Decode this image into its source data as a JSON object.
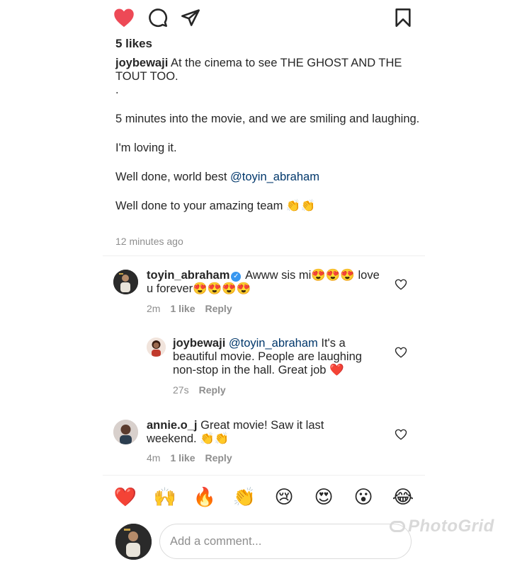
{
  "post": {
    "likes": "5 likes",
    "caption_user": "joybewaji",
    "caption_line1": "At the cinema to see THE GHOST AND THE TOUT TOO.",
    "caption_dot": ".",
    "caption_line2": "5 minutes into the movie, and we are smiling and laughing.",
    "caption_line3": "I'm loving it.",
    "caption_line4_prefix": "Well done, world best ",
    "caption_line4_mention": "@toyin_abraham",
    "caption_line5": "Well done to your amazing team 👏👏",
    "time_posted": "12 minutes ago"
  },
  "icons": {
    "like": "heart-filled-icon",
    "comment": "comment-icon",
    "share": "share-icon",
    "save": "bookmark-icon",
    "like_color": "#ed4956"
  },
  "comments": [
    {
      "user": "toyin_abraham",
      "verified": true,
      "text": "Awww sis mi😍😍😍 love u forever😍😍😍😍",
      "time": "2m",
      "likes": "1 like",
      "reply": "Reply"
    },
    {
      "user": "joybewaji",
      "mention": "@toyin_abraham",
      "text": "It's a beautiful movie. People are laughing non-stop in the hall. Great job ❤️",
      "time": "27s",
      "reply": "Reply"
    },
    {
      "user": "annie.o_j",
      "text": "Great movie! Saw it last weekend. 👏👏",
      "time": "4m",
      "likes": "1 like",
      "reply": "Reply"
    }
  ],
  "emoji_bar": [
    "❤️",
    "🙌",
    "🔥",
    "👏",
    "😢",
    "😍",
    "😮",
    "😂"
  ],
  "comment_input": {
    "placeholder": "Add a comment..."
  },
  "watermark": "PhotoGrid"
}
